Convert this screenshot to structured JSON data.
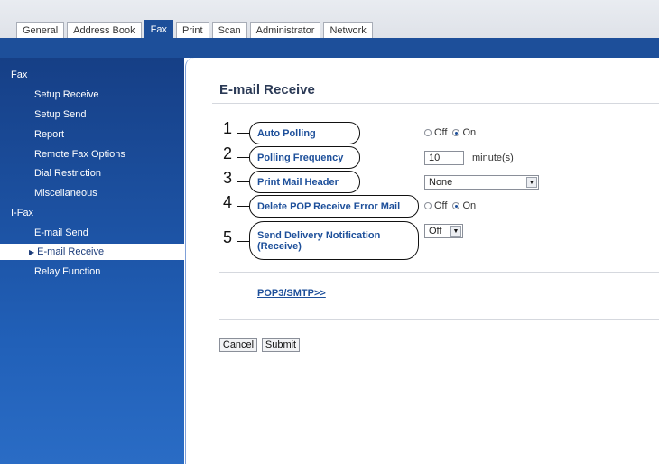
{
  "tabs": [
    {
      "label": "General"
    },
    {
      "label": "Address Book"
    },
    {
      "label": "Fax"
    },
    {
      "label": "Print"
    },
    {
      "label": "Scan"
    },
    {
      "label": "Administrator"
    },
    {
      "label": "Network"
    }
  ],
  "sidebar": {
    "items": [
      {
        "label": "Fax"
      },
      {
        "label": "Setup Receive"
      },
      {
        "label": "Setup Send"
      },
      {
        "label": "Report"
      },
      {
        "label": "Remote Fax Options"
      },
      {
        "label": "Dial Restriction"
      },
      {
        "label": "Miscellaneous"
      },
      {
        "label": "I-Fax"
      },
      {
        "label": "E-mail Send"
      },
      {
        "label": "E-mail Receive"
      },
      {
        "label": "Relay Function"
      }
    ]
  },
  "page": {
    "title": "E-mail Receive"
  },
  "settings": {
    "auto_polling": {
      "number": "1",
      "label": "Auto Polling",
      "options": [
        "Off",
        "On"
      ],
      "selected": "On"
    },
    "polling_frequency": {
      "number": "2",
      "label": "Polling Frequency",
      "value": "10",
      "unit": "minute(s)"
    },
    "print_mail_header": {
      "number": "3",
      "label": "Print Mail Header",
      "value": "None"
    },
    "delete_pop_error": {
      "number": "4",
      "label": "Delete POP Receive Error Mail",
      "options": [
        "Off",
        "On"
      ],
      "selected": "On"
    },
    "send_delivery_notification": {
      "number": "5",
      "label_line1": "Send Delivery Notification",
      "label_line2": "(Receive)",
      "value": "Off"
    }
  },
  "links": {
    "pop3_smtp": "POP3/SMTP>>"
  },
  "buttons": {
    "cancel": "Cancel",
    "submit": "Submit"
  },
  "colors": {
    "accent": "#1d4f9a"
  }
}
